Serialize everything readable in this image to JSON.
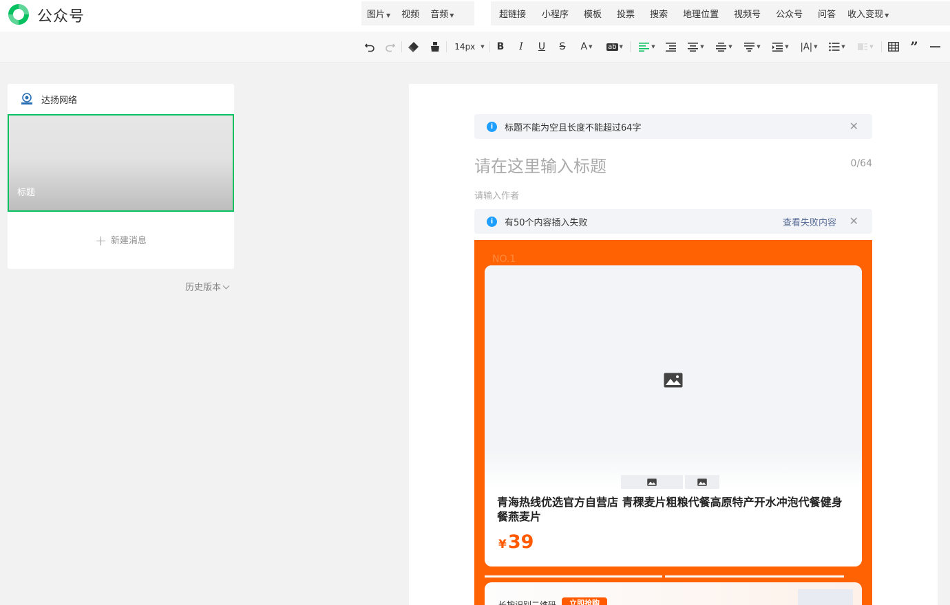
{
  "app": {
    "name": "公众号",
    "brand_color": "#07c160",
    "accent_color": "#ff6203"
  },
  "insert_menu": {
    "group1": [
      {
        "label": "图片",
        "dropdown": true
      },
      {
        "label": "视频",
        "dropdown": false
      },
      {
        "label": "音频",
        "dropdown": true
      }
    ],
    "group2": [
      {
        "label": "超链接",
        "dropdown": false
      },
      {
        "label": "小程序",
        "dropdown": false
      },
      {
        "label": "模板",
        "dropdown": false
      },
      {
        "label": "投票",
        "dropdown": false
      },
      {
        "label": "搜索",
        "dropdown": false
      },
      {
        "label": "地理位置",
        "dropdown": false
      },
      {
        "label": "视频号",
        "dropdown": false
      },
      {
        "label": "公众号",
        "dropdown": false
      },
      {
        "label": "问答",
        "dropdown": false
      },
      {
        "label": "收入变现",
        "dropdown": true
      }
    ]
  },
  "toolbar": {
    "font_size": "14px",
    "bold": "B",
    "italic": "I",
    "underline": "U",
    "strike": "S",
    "font_color": "A",
    "highlight": "ab",
    "letter_spacing": "|A|",
    "icons": [
      "undo-icon",
      "redo-icon",
      "eraser-icon",
      "format-painter-icon",
      "align-left-icon",
      "indent-icon",
      "align-center-icon",
      "line-height-icon",
      "paragraph-spacing-icon",
      "list-indent-icon",
      "bullet-list-icon",
      "table-icon",
      "quote-icon",
      "horizontal-rule-icon"
    ]
  },
  "sidebar": {
    "account_name": "达扬网络",
    "cover_title": "标题",
    "new_message": "新建消息",
    "history": "历史版本"
  },
  "editor": {
    "title_alert": "标题不能为空且长度不能超过64字",
    "title_placeholder": "请在这里输入标题",
    "title_count": "0/64",
    "author_placeholder": "请输入作者",
    "insert_alert": "有50个内容插入失败",
    "insert_alert_link": "查看失败内容"
  },
  "product": {
    "rank": "NO.1",
    "name": "青海热线优选官方自营店 青稞麦片粗粮代餐高原特产开水冲泡代餐健身餐燕麦片",
    "currency": "¥",
    "price": "39",
    "card2_text": "长按识别二维码",
    "card2_button": "立即抢购"
  }
}
